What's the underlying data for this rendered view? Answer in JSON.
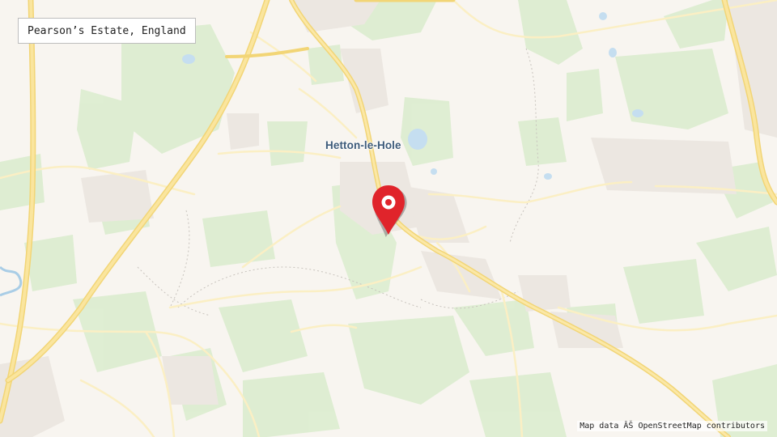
{
  "map": {
    "place_title": "Pearson’s Estate, England",
    "town_label": "Hetton-le-Hole",
    "attribution": "Map data ÂŠ OpenStreetMap contributors",
    "marker_icon": "location-pin-icon",
    "colors": {
      "background": "#f8f5f0",
      "green": "#d9eccc",
      "water": "#c6dff0",
      "road_major": "#f7e08a",
      "road_minor": "#fdf6d8",
      "urban": "#ebe6e0",
      "pin": "#e0242b"
    }
  }
}
